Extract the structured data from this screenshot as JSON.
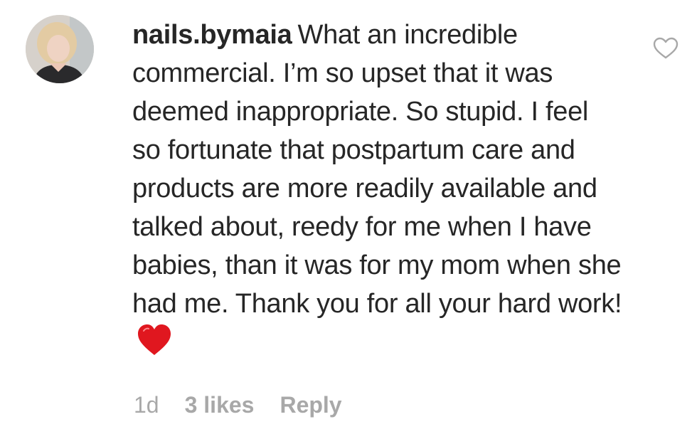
{
  "comment": {
    "username": "nails.bymaia",
    "text": "What an incredible commercial. I’m so upset that it was deemed inappropriate. So stupid. I feel so fortunate that postpartum care and products are more readily available and talked about, reedy for me when I have babies, than it was for my mom when she had me. Thank you for all your hard work!",
    "emoji": "red-heart-emoji",
    "timestamp": "1d",
    "likes": "3 likes",
    "reply_label": "Reply",
    "like_icon": "heart-outline-icon"
  },
  "colors": {
    "text": "#262626",
    "meta": "#a8a8a8",
    "heart_emoji": "#e0171f",
    "like_icon_stroke": "#a8a8a8"
  }
}
